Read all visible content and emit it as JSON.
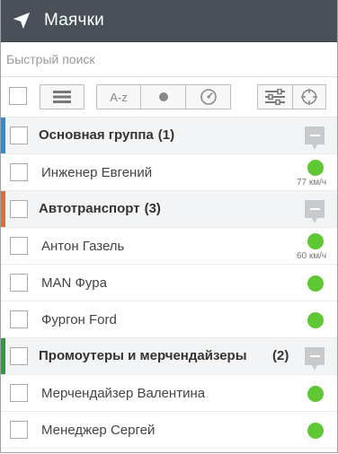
{
  "header": {
    "title": "Маячки",
    "icon": "navigation-arrow-icon"
  },
  "search": {
    "placeholder": "Быстрый поиск",
    "value": ""
  },
  "toolbar": {
    "sort_label": "A-z",
    "buttons": [
      "select-all-checkbox",
      "menu-icon",
      "sort-alpha",
      "status-dot-icon",
      "speed-gauge-icon",
      "settings-sliders-icon",
      "crosshair-target-icon"
    ]
  },
  "colors": {
    "header_bg": "#4a5057",
    "status_online": "#5ec733",
    "group_main": "#2b8ed6",
    "group_auto": "#e06e2c",
    "group_promo": "#2e9a3a"
  },
  "groups": [
    {
      "name": "Основная группа",
      "count": "(1)",
      "items": [
        {
          "name": "Инженер Евгений",
          "speed": "77 км/ч"
        }
      ]
    },
    {
      "name": "Автотранспорт",
      "count": "(3)",
      "items": [
        {
          "name": "Антон Газель",
          "speed": "60 км/ч"
        },
        {
          "name": "MAN Фура",
          "speed": ""
        },
        {
          "name": "Фургон Ford",
          "speed": ""
        }
      ]
    },
    {
      "name": "Промоутеры и мерчендайзеры",
      "count": "(2)",
      "items": [
        {
          "name": "Мерчендайзер Валентина",
          "speed": ""
        },
        {
          "name": "Менеджер Сергей",
          "speed": ""
        }
      ]
    }
  ]
}
